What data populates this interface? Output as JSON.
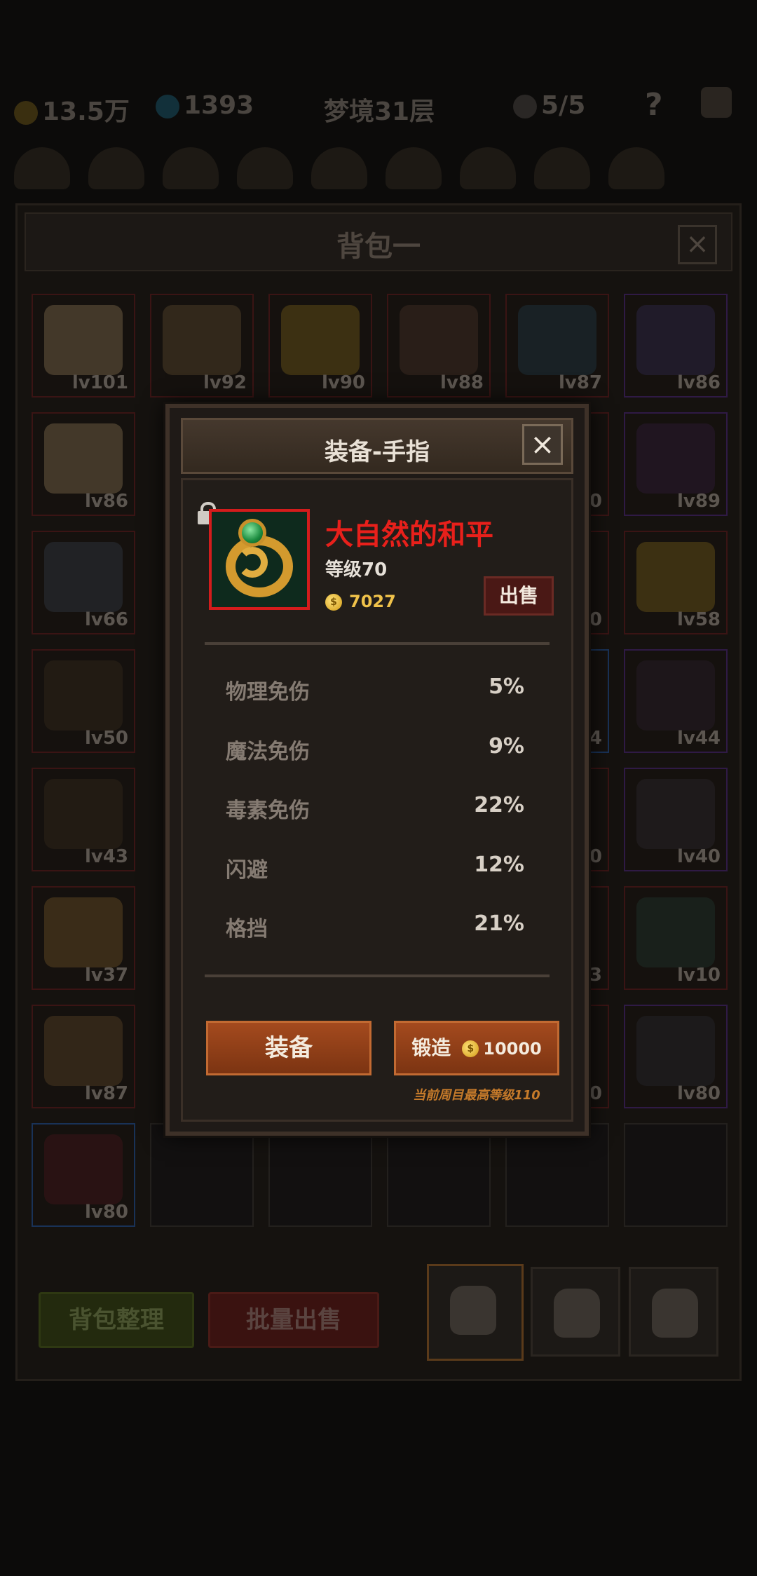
{
  "top_bar": {
    "gold": "13.5万",
    "gems": "1393",
    "floor": "梦境31层",
    "skulls": "5/5",
    "help": "?"
  },
  "bag": {
    "title": "背包一",
    "close": "×",
    "slots": [
      "lv101",
      "lv92",
      "lv90",
      "lv88",
      "lv87",
      "lv86",
      "lv86",
      "",
      "",
      "",
      "0",
      "lv89",
      "lv66",
      "",
      "",
      "",
      "0",
      "lv58",
      "lv50",
      "",
      "",
      "",
      "4",
      "lv44",
      "lv43",
      "",
      "",
      "",
      "0",
      "lv40",
      "lv37",
      "",
      "",
      "",
      "3",
      "lv10",
      "lv87",
      "",
      "",
      "",
      "0",
      "lv80",
      "lv80",
      "",
      "",
      "",
      "",
      ""
    ],
    "sort_button": "背包整理",
    "bulk_sell_button": "批量出售",
    "colors": {
      "red_border": "#3a1414",
      "blue_border": "#193257",
      "purple_border": "#2f1a45"
    }
  },
  "dialog": {
    "title": "装备-手指",
    "close": "×",
    "item": {
      "name": "大自然的和平",
      "level": "等级70",
      "price": "7027",
      "icon": "green-gem-ring-icon",
      "locked": true,
      "rarity_color": "#d31c1c"
    },
    "sell_button": "出售",
    "stats": [
      {
        "label": "物理免伤",
        "value": "5%"
      },
      {
        "label": "魔法免伤",
        "value": "9%"
      },
      {
        "label": "毒素免伤",
        "value": "22%"
      },
      {
        "label": "闪避",
        "value": "12%"
      },
      {
        "label": "格挡",
        "value": "21%"
      }
    ],
    "equip_button": "装备",
    "forge_button": "锻造",
    "forge_cost": "10000",
    "coin_symbol": "$",
    "note": "当前周目最高等级110"
  }
}
